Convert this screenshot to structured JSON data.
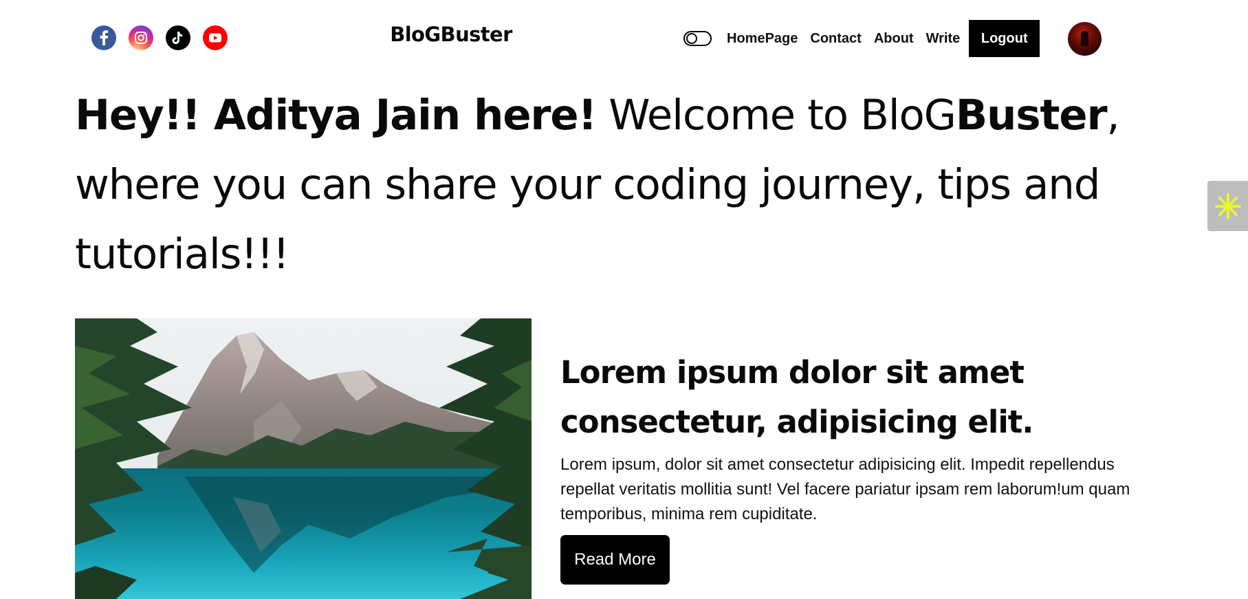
{
  "navbar": {
    "social": [
      {
        "name": "facebook-icon",
        "color": "#3b5998"
      },
      {
        "name": "instagram-icon",
        "color": "#d6249f"
      },
      {
        "name": "tiktok-icon",
        "color": "#000000"
      },
      {
        "name": "youtube-icon",
        "color": "#ff0000"
      }
    ],
    "brand": "BloGBuster",
    "links": {
      "home": "HomePage",
      "contact": "Contact",
      "about": "About",
      "write": "Write"
    },
    "logout_label": "Logout",
    "theme_toggle_icon": "toggle-icon",
    "avatar_icon": "user-avatar"
  },
  "hero": {
    "bold_part": "Hey!! Aditya Jain here!",
    "text_part_1": " Welcome to BloG",
    "brand_bold": "Buster",
    "text_part_2": ", where you can share your coding journey, tips and tutorials!!!"
  },
  "side_widget": {
    "icon": "asterisk-icon",
    "color": "#e8f531"
  },
  "post": {
    "image_icon": "mountain-lake-image",
    "title": "Lorem ipsum dolor sit amet consectetur, adipisicing elit.",
    "description": "Lorem ipsum, dolor sit amet consectetur adipisicing elit. Impedit repellendus repellat veritatis mollitia sunt! Vel facere pariatur ipsam rem laborum!um quam temporibus, minima rem cupiditate.",
    "read_more_label": "Read More"
  }
}
